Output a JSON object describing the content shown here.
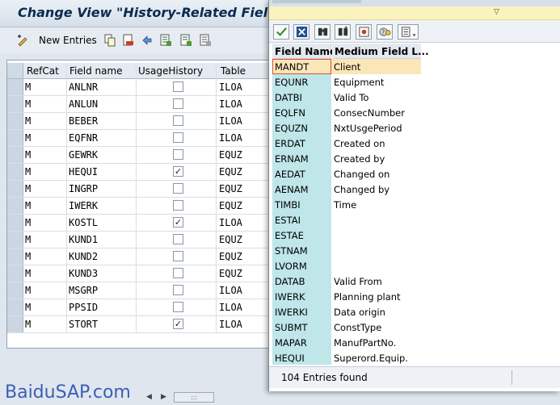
{
  "window": {
    "title": "Change View \"History-Related Fields"
  },
  "toolbar": {
    "new_entries_label": "New Entries",
    "icons": [
      "edit-pencil-icon",
      "copy-icon",
      "delete-icon",
      "undo-icon",
      "select-all-icon",
      "select-block-icon",
      "deselect-all-icon"
    ]
  },
  "table": {
    "columns": [
      "RefCat",
      "Field name",
      "UsageHistory",
      "Table"
    ],
    "rows": [
      {
        "refcat": "M",
        "field": "ANLNR",
        "usage": "",
        "table": "ILOA"
      },
      {
        "refcat": "M",
        "field": "ANLUN",
        "usage": "",
        "table": "ILOA"
      },
      {
        "refcat": "M",
        "field": "BEBER",
        "usage": "",
        "table": "ILOA"
      },
      {
        "refcat": "M",
        "field": "EQFNR",
        "usage": "",
        "table": "ILOA"
      },
      {
        "refcat": "M",
        "field": "GEWRK",
        "usage": "",
        "table": "EQUZ"
      },
      {
        "refcat": "M",
        "field": "HEQUI",
        "usage": "✓",
        "table": "EQUZ"
      },
      {
        "refcat": "M",
        "field": "INGRP",
        "usage": "",
        "table": "EQUZ"
      },
      {
        "refcat": "M",
        "field": "IWERK",
        "usage": "",
        "table": "EQUZ"
      },
      {
        "refcat": "M",
        "field": "KOSTL",
        "usage": "✓",
        "table": "ILOA"
      },
      {
        "refcat": "M",
        "field": "KUND1",
        "usage": "",
        "table": "EQUZ"
      },
      {
        "refcat": "M",
        "field": "KUND2",
        "usage": "",
        "table": "EQUZ"
      },
      {
        "refcat": "M",
        "field": "KUND3",
        "usage": "",
        "table": "EQUZ"
      },
      {
        "refcat": "M",
        "field": "MSGRP",
        "usage": "",
        "table": "ILOA"
      },
      {
        "refcat": "M",
        "field": "PPSID",
        "usage": "",
        "table": "ILOA"
      },
      {
        "refcat": "M",
        "field": "STORT",
        "usage": "✓",
        "table": "ILOA"
      }
    ],
    "scroll_thumb_text": ":::"
  },
  "popup": {
    "columns": [
      "Field Name",
      "Medium Field L..."
    ],
    "toolbar_icons": [
      "checkmark-icon",
      "close-icon",
      "find-icon",
      "find-next-icon",
      "settings-icon",
      "info-icon",
      "print-icon"
    ],
    "rows": [
      {
        "name": "MANDT",
        "desc": "Client"
      },
      {
        "name": "EQUNR",
        "desc": "Equipment"
      },
      {
        "name": "DATBI",
        "desc": "Valid To"
      },
      {
        "name": "EQLFN",
        "desc": "ConsecNumber"
      },
      {
        "name": "EQUZN",
        "desc": "NxtUsgePeriod"
      },
      {
        "name": "ERDAT",
        "desc": "Created on"
      },
      {
        "name": "ERNAM",
        "desc": "Created by"
      },
      {
        "name": "AEDAT",
        "desc": "Changed on"
      },
      {
        "name": "AENAM",
        "desc": "Changed by"
      },
      {
        "name": "TIMBI",
        "desc": "Time"
      },
      {
        "name": "ESTAI",
        "desc": ""
      },
      {
        "name": "ESTAE",
        "desc": ""
      },
      {
        "name": "STNAM",
        "desc": ""
      },
      {
        "name": "LVORM",
        "desc": ""
      },
      {
        "name": "DATAB",
        "desc": "Valid From"
      },
      {
        "name": "IWERK",
        "desc": "Planning plant"
      },
      {
        "name": "IWERKI",
        "desc": "Data origin"
      },
      {
        "name": "SUBMT",
        "desc": "ConstType"
      },
      {
        "name": "MAPAR",
        "desc": "ManufPartNo."
      },
      {
        "name": "HEQUI",
        "desc": "Superord.Equip."
      }
    ],
    "status": "104 Entries found"
  },
  "watermark": "BaiduSAP.com"
}
